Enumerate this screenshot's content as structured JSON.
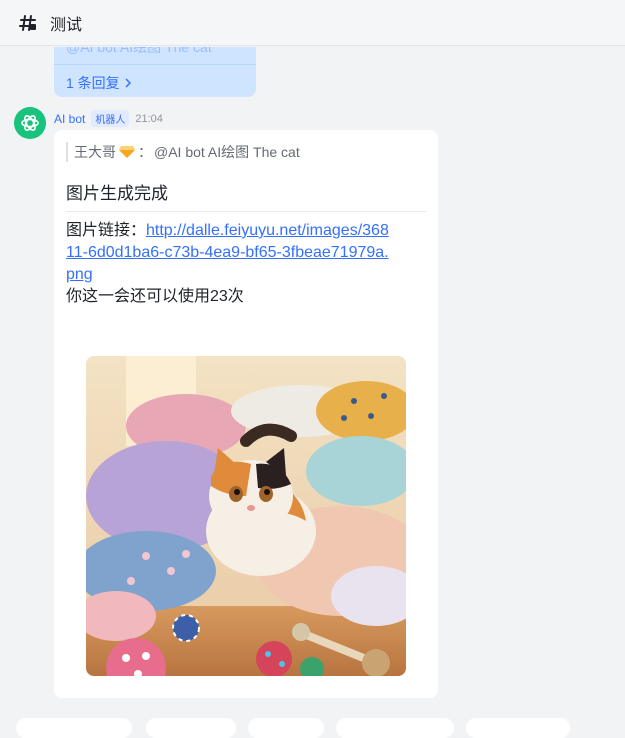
{
  "header": {
    "title": "测试",
    "icon": "channel-thread-icon"
  },
  "previous_message": {
    "ghost_text": "@AI bot AI绘图 The cat",
    "reply_link": "1 条回复"
  },
  "message": {
    "sender": "AI bot",
    "badge": "机器人",
    "time": "21:04",
    "quote": {
      "author": "王大哥",
      "separator": "：",
      "text": "@AI bot AI绘图 The cat"
    },
    "title": "图片生成完成",
    "link_label": "图片链接：",
    "link_url": "http://dalle.feiyuyu.net/images/36811-6d0d1ba6-c73b-4ea9-bf65-3fbeae71979a.png",
    "remaining_text": "你这一会还可以使用23次",
    "image_alt": "cat-among-pillows-image"
  },
  "colors": {
    "accent": "#3370ff",
    "avatar_bg": "#19c37d",
    "bubble_bg": "#cfe5ff",
    "page_bg": "#f2f3f5"
  }
}
